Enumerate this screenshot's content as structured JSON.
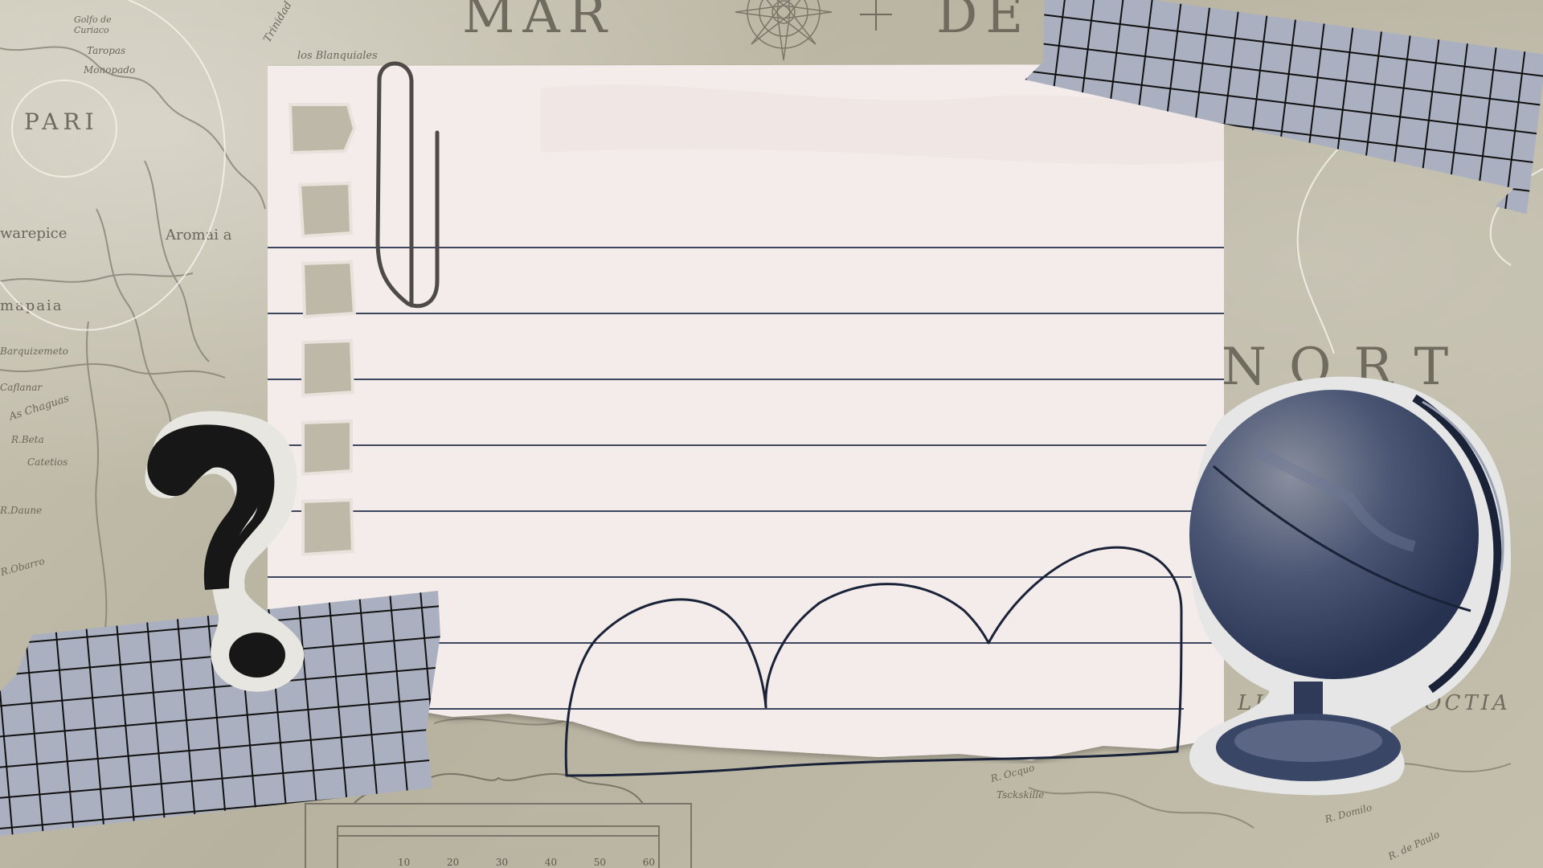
{
  "map_labels": {
    "top_left_a": "MAR",
    "top_left_b": "DE",
    "right_mid": "NORT",
    "bottom_right": "LINEA AQVINOCTIA",
    "pari": "PARI",
    "warepice": "warepice",
    "aromai": "Aromai a",
    "mapaia": "mapaia",
    "golfo": "Golfo de Curiaco",
    "blanquilla": "los Blanquiales",
    "trinidad": "Trinidad",
    "tanopas": "Taropas",
    "monopado": "Monopado",
    "barquezemeto": "Barquizemeto",
    "caflanar": "Caflanar",
    "as_chaguas": "As Chaguas",
    "rbeta": "R.Beta",
    "catetios": "Catetios",
    "rdaune": "R.Daune",
    "robarro": "R.Obarro",
    "ocquo": "R. Ocquo",
    "tsckskille": "Tsckskille",
    "rdomilo": "R. Domilo",
    "rdepaulo": "R. de Paulo"
  },
  "scale_ticks": [
    "10",
    "20",
    "30",
    "40",
    "50",
    "60"
  ],
  "colors": {
    "ink": "#1a2238",
    "paper": "#f4ecea",
    "tape": "#aab0bf",
    "globe": "#3c4a68"
  }
}
